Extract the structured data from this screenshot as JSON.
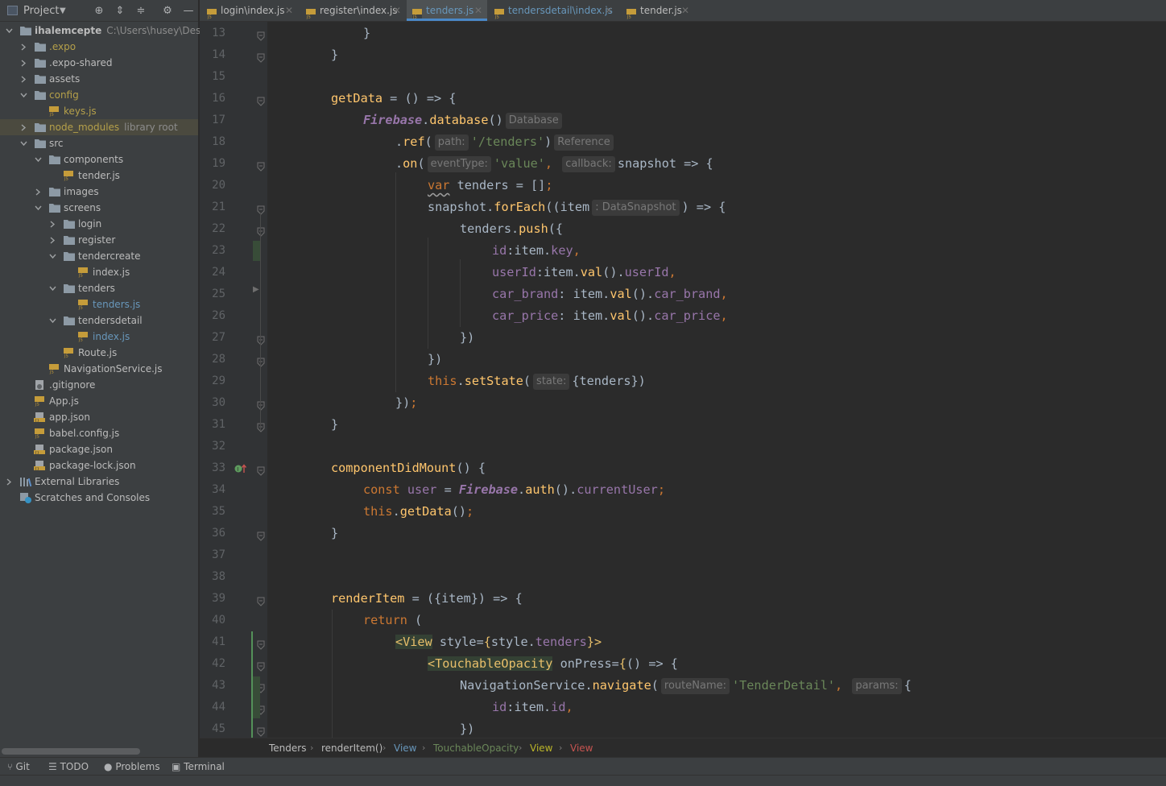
{
  "project_panel": {
    "title": "Project"
  },
  "tree": [
    {
      "label": "ihalemcepte",
      "extra": "C:\\Users\\husey\\Desktop\\",
      "bold": true
    },
    {
      "label": ".expo",
      "color": "#b5a04a"
    },
    {
      "label": ".expo-shared"
    },
    {
      "label": "assets"
    },
    {
      "label": "config",
      "color": "#b5a04a"
    },
    {
      "label": "keys.js",
      "color": "#b5a04a"
    },
    {
      "label": "node_modules",
      "extra": "library root",
      "color": "#b5a04a"
    },
    {
      "label": "src"
    },
    {
      "label": "components"
    },
    {
      "label": "tender.js"
    },
    {
      "label": "images"
    },
    {
      "label": "screens"
    },
    {
      "label": "login"
    },
    {
      "label": "register"
    },
    {
      "label": "tendercreate"
    },
    {
      "label": "index.js"
    },
    {
      "label": "tenders"
    },
    {
      "label": "tenders.js",
      "color": "#6897bb"
    },
    {
      "label": "tendersdetail"
    },
    {
      "label": "index.js",
      "color": "#6897bb"
    },
    {
      "label": "Route.js"
    },
    {
      "label": "NavigationService.js"
    },
    {
      "label": ".gitignore"
    },
    {
      "label": "App.js"
    },
    {
      "label": "app.json"
    },
    {
      "label": "babel.config.js"
    },
    {
      "label": "package.json"
    },
    {
      "label": "package-lock.json"
    },
    {
      "label": "External Libraries"
    },
    {
      "label": "Scratches and Consoles"
    }
  ],
  "tabs": [
    {
      "label": "login\\index.js"
    },
    {
      "label": "register\\index.js"
    },
    {
      "label": "tenders.js",
      "active": true
    },
    {
      "label": "tendersdetail\\index.js"
    },
    {
      "label": "tender.js"
    }
  ],
  "line_numbers": [
    "13",
    "14",
    "15",
    "16",
    "17",
    "18",
    "19",
    "20",
    "21",
    "22",
    "23",
    "24",
    "25",
    "26",
    "27",
    "28",
    "29",
    "30",
    "31",
    "32",
    "33",
    "34",
    "35",
    "36",
    "37",
    "38",
    "39",
    "40",
    "41",
    "42",
    "43",
    "44",
    "45"
  ],
  "hints": {
    "database": "Database",
    "path": "path:",
    "reference": "Reference",
    "event_type": "eventType:",
    "callback": "callback:",
    "data_snapshot": ": DataSnapshot",
    "state": "state:",
    "route_name": "routeName:",
    "params": "params:"
  },
  "breadcrumbs": [
    "Tenders",
    "renderItem()",
    "View",
    "TouchableOpacity",
    "View",
    "View"
  ],
  "bottom_tools": [
    "Git",
    "TODO",
    "Problems",
    "Terminal"
  ],
  "colors": {
    "keyword": "#cc7832",
    "function": "#ffc66d",
    "property": "#9876aa",
    "string": "#6a8759",
    "plain": "#a9b7c6",
    "tag": "#e8bf6a"
  }
}
